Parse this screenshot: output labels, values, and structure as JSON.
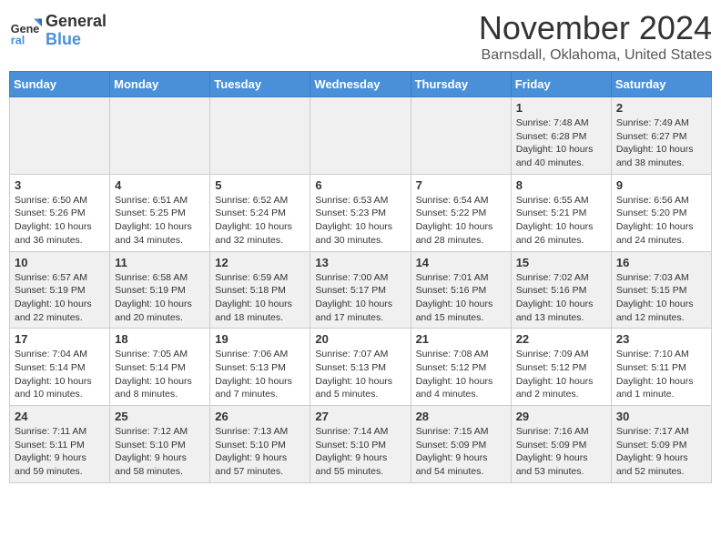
{
  "header": {
    "logo_general": "General",
    "logo_blue": "Blue",
    "month": "November 2024",
    "location": "Barnsdall, Oklahoma, United States"
  },
  "weekdays": [
    "Sunday",
    "Monday",
    "Tuesday",
    "Wednesday",
    "Thursday",
    "Friday",
    "Saturday"
  ],
  "weeks": [
    [
      {
        "day": "",
        "info": ""
      },
      {
        "day": "",
        "info": ""
      },
      {
        "day": "",
        "info": ""
      },
      {
        "day": "",
        "info": ""
      },
      {
        "day": "",
        "info": ""
      },
      {
        "day": "1",
        "info": "Sunrise: 7:48 AM\nSunset: 6:28 PM\nDaylight: 10 hours and 40 minutes."
      },
      {
        "day": "2",
        "info": "Sunrise: 7:49 AM\nSunset: 6:27 PM\nDaylight: 10 hours and 38 minutes."
      }
    ],
    [
      {
        "day": "3",
        "info": "Sunrise: 6:50 AM\nSunset: 5:26 PM\nDaylight: 10 hours and 36 minutes."
      },
      {
        "day": "4",
        "info": "Sunrise: 6:51 AM\nSunset: 5:25 PM\nDaylight: 10 hours and 34 minutes."
      },
      {
        "day": "5",
        "info": "Sunrise: 6:52 AM\nSunset: 5:24 PM\nDaylight: 10 hours and 32 minutes."
      },
      {
        "day": "6",
        "info": "Sunrise: 6:53 AM\nSunset: 5:23 PM\nDaylight: 10 hours and 30 minutes."
      },
      {
        "day": "7",
        "info": "Sunrise: 6:54 AM\nSunset: 5:22 PM\nDaylight: 10 hours and 28 minutes."
      },
      {
        "day": "8",
        "info": "Sunrise: 6:55 AM\nSunset: 5:21 PM\nDaylight: 10 hours and 26 minutes."
      },
      {
        "day": "9",
        "info": "Sunrise: 6:56 AM\nSunset: 5:20 PM\nDaylight: 10 hours and 24 minutes."
      }
    ],
    [
      {
        "day": "10",
        "info": "Sunrise: 6:57 AM\nSunset: 5:19 PM\nDaylight: 10 hours and 22 minutes."
      },
      {
        "day": "11",
        "info": "Sunrise: 6:58 AM\nSunset: 5:19 PM\nDaylight: 10 hours and 20 minutes."
      },
      {
        "day": "12",
        "info": "Sunrise: 6:59 AM\nSunset: 5:18 PM\nDaylight: 10 hours and 18 minutes."
      },
      {
        "day": "13",
        "info": "Sunrise: 7:00 AM\nSunset: 5:17 PM\nDaylight: 10 hours and 17 minutes."
      },
      {
        "day": "14",
        "info": "Sunrise: 7:01 AM\nSunset: 5:16 PM\nDaylight: 10 hours and 15 minutes."
      },
      {
        "day": "15",
        "info": "Sunrise: 7:02 AM\nSunset: 5:16 PM\nDaylight: 10 hours and 13 minutes."
      },
      {
        "day": "16",
        "info": "Sunrise: 7:03 AM\nSunset: 5:15 PM\nDaylight: 10 hours and 12 minutes."
      }
    ],
    [
      {
        "day": "17",
        "info": "Sunrise: 7:04 AM\nSunset: 5:14 PM\nDaylight: 10 hours and 10 minutes."
      },
      {
        "day": "18",
        "info": "Sunrise: 7:05 AM\nSunset: 5:14 PM\nDaylight: 10 hours and 8 minutes."
      },
      {
        "day": "19",
        "info": "Sunrise: 7:06 AM\nSunset: 5:13 PM\nDaylight: 10 hours and 7 minutes."
      },
      {
        "day": "20",
        "info": "Sunrise: 7:07 AM\nSunset: 5:13 PM\nDaylight: 10 hours and 5 minutes."
      },
      {
        "day": "21",
        "info": "Sunrise: 7:08 AM\nSunset: 5:12 PM\nDaylight: 10 hours and 4 minutes."
      },
      {
        "day": "22",
        "info": "Sunrise: 7:09 AM\nSunset: 5:12 PM\nDaylight: 10 hours and 2 minutes."
      },
      {
        "day": "23",
        "info": "Sunrise: 7:10 AM\nSunset: 5:11 PM\nDaylight: 10 hours and 1 minute."
      }
    ],
    [
      {
        "day": "24",
        "info": "Sunrise: 7:11 AM\nSunset: 5:11 PM\nDaylight: 9 hours and 59 minutes."
      },
      {
        "day": "25",
        "info": "Sunrise: 7:12 AM\nSunset: 5:10 PM\nDaylight: 9 hours and 58 minutes."
      },
      {
        "day": "26",
        "info": "Sunrise: 7:13 AM\nSunset: 5:10 PM\nDaylight: 9 hours and 57 minutes."
      },
      {
        "day": "27",
        "info": "Sunrise: 7:14 AM\nSunset: 5:10 PM\nDaylight: 9 hours and 55 minutes."
      },
      {
        "day": "28",
        "info": "Sunrise: 7:15 AM\nSunset: 5:09 PM\nDaylight: 9 hours and 54 minutes."
      },
      {
        "day": "29",
        "info": "Sunrise: 7:16 AM\nSunset: 5:09 PM\nDaylight: 9 hours and 53 minutes."
      },
      {
        "day": "30",
        "info": "Sunrise: 7:17 AM\nSunset: 5:09 PM\nDaylight: 9 hours and 52 minutes."
      }
    ]
  ]
}
